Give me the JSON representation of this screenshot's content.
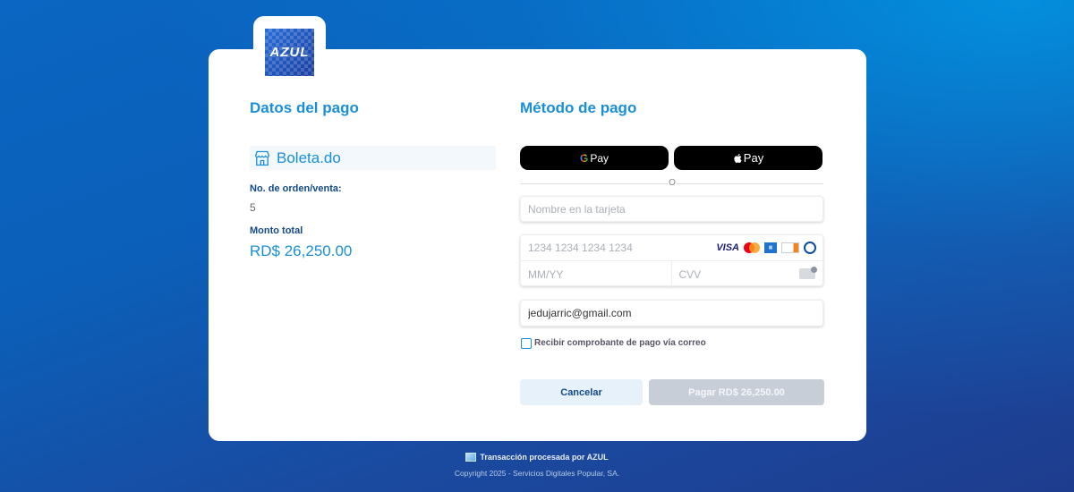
{
  "brand": {
    "logo_text": "AZUL"
  },
  "left": {
    "title": "Datos del pago",
    "merchant": {
      "icon": "storefront-icon",
      "name": "Boleta.do"
    },
    "order_label": "No. de orden/venta:",
    "order_value": "5",
    "total_label": "Monto total",
    "total_value": "RD$ 26,250.00"
  },
  "right": {
    "title": "Método de pago",
    "google_pay_label": "Pay",
    "apple_pay_label": "Pay",
    "divider_text": "O",
    "card_name_placeholder": "Nombre en la tarjeta",
    "card_number_placeholder": "1234 1234 1234 1234",
    "card_brands": {
      "visa": "VISA",
      "amex": "AMEX",
      "discover": "DISCOVER"
    },
    "expiry_placeholder": "MM/YY",
    "cvv_placeholder": "CVV",
    "email_value": "jedujarric@gmail.com",
    "receipt_checkbox_label": "Recibir comprobante de pago vía correo",
    "receipt_checked": false,
    "cancel_label": "Cancelar",
    "pay_label": "Pagar RD$ 26,250.00"
  },
  "footer": {
    "processed_by": "Transacción procesada por AZUL",
    "copyright": "Copyright 2025 - Servicios Digitales Popular, SA."
  },
  "colors": {
    "accent": "#1a8fd6",
    "dark_blue": "#124a8a",
    "pay_disabled": "#c7ced8"
  }
}
